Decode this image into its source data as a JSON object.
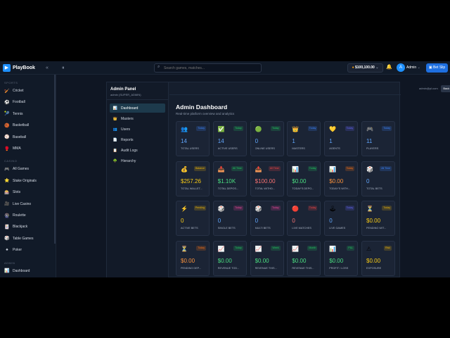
{
  "app": {
    "name": "PlayBook",
    "collapse_icon": "«",
    "menu_icon": "⏸"
  },
  "header": {
    "search_placeholder": "Search games, matches...",
    "balance": "$100,100.00",
    "user": "Admin",
    "avatar_letter": "A",
    "bet_slip": "Bet Slip"
  },
  "sidebar": {
    "sections": [
      {
        "title": "SPORTS",
        "items": [
          {
            "label": "Cricket",
            "icon": "🏏"
          },
          {
            "label": "Football",
            "icon": "⚽"
          },
          {
            "label": "Tennis",
            "icon": "🎾"
          },
          {
            "label": "Basketball",
            "icon": "🏀"
          },
          {
            "label": "Baseball",
            "icon": "⚾"
          },
          {
            "label": "MMA",
            "icon": "🥊"
          }
        ]
      },
      {
        "title": "CASINO",
        "items": [
          {
            "label": "All Games",
            "icon": "🎮"
          },
          {
            "label": "Stake Originals",
            "icon": "⭐"
          },
          {
            "label": "Slots",
            "icon": "🎰"
          },
          {
            "label": "Live Casino",
            "icon": "🎥"
          },
          {
            "label": "Roulette",
            "icon": "🎡"
          },
          {
            "label": "Blackjack",
            "icon": "🃏"
          },
          {
            "label": "Table Games",
            "icon": "🎲"
          },
          {
            "label": "Poker",
            "icon": "♠"
          }
        ]
      },
      {
        "title": "ADMIN",
        "items": [
          {
            "label": "Dashboard",
            "icon": "📊"
          }
        ]
      }
    ]
  },
  "admin_panel": {
    "title": "Admin Panel",
    "subtitle": "admin (SUPER_ADMIN)",
    "email": "admin@pl.com",
    "back_label": "Back to Site",
    "nav": [
      {
        "label": "Dashboard",
        "icon": "📊",
        "active": true
      },
      {
        "label": "Masters",
        "icon": "👑",
        "active": false
      },
      {
        "label": "Users",
        "icon": "👥",
        "active": false
      },
      {
        "label": "Reports",
        "icon": "📄",
        "active": false
      },
      {
        "label": "Audit Logs",
        "icon": "📋",
        "active": false
      },
      {
        "label": "Hierarchy",
        "icon": "🌳",
        "active": false
      }
    ]
  },
  "dashboard": {
    "title": "Admin Dashboard",
    "subtitle": "Real-time platform overview and analytics",
    "cards": [
      {
        "icon": "👥",
        "badge": "Today",
        "badge_color": "#3b82f6",
        "value": "14",
        "value_color": "#60a5fa",
        "label": "TOTAL USERS"
      },
      {
        "icon": "✅",
        "badge": "Today",
        "badge_color": "#22c55e",
        "value": "14",
        "value_color": "#60a5fa",
        "label": "ACTIVE USERS"
      },
      {
        "icon": "🟢",
        "badge": "Today",
        "badge_color": "#22c55e",
        "value": "0",
        "value_color": "#60a5fa",
        "label": "ONLINE USERS"
      },
      {
        "icon": "👑",
        "badge": "Today",
        "badge_color": "#3b82f6",
        "value": "1",
        "value_color": "#60a5fa",
        "label": "MASTERS"
      },
      {
        "icon": "💛",
        "badge": "Today",
        "badge_color": "#6366f1",
        "value": "1",
        "value_color": "#60a5fa",
        "label": "AGENTS"
      },
      {
        "icon": "🎮",
        "badge": "Today",
        "badge_color": "#3b82f6",
        "value": "11",
        "value_color": "#60a5fa",
        "label": "PLAYERS"
      },
      {
        "icon": "💰",
        "badge": "Balance",
        "badge_color": "#eab308",
        "value": "$257.26",
        "value_color": "#facc15",
        "label": "TOTAL WALLET..."
      },
      {
        "icon": "📥",
        "badge": "All Time",
        "badge_color": "#22c55e",
        "value": "$1.10K",
        "value_color": "#4ade80",
        "label": "TOTAL DEPOS..."
      },
      {
        "icon": "📤",
        "badge": "All Time",
        "badge_color": "#ef4444",
        "value": "$100.00",
        "value_color": "#f87171",
        "label": "TOTAL WITHD..."
      },
      {
        "icon": "📊",
        "badge": "Today",
        "badge_color": "#22c55e",
        "value": "$0.00",
        "value_color": "#4ade80",
        "label": "TODAY'S DEPO..."
      },
      {
        "icon": "📊",
        "badge": "Today",
        "badge_color": "#f97316",
        "value": "$0.00",
        "value_color": "#fb923c",
        "label": "TODAY'S WITH..."
      },
      {
        "icon": "🎲",
        "badge": "All Time",
        "badge_color": "#3b82f6",
        "value": "0",
        "value_color": "#60a5fa",
        "label": "TOTAL BETS"
      },
      {
        "icon": "⚡",
        "badge": "Pending",
        "badge_color": "#eab308",
        "value": "0",
        "value_color": "#facc15",
        "label": "ACTIVE BETS"
      },
      {
        "icon": "🎲",
        "badge": "Today",
        "badge_color": "#ec4899",
        "value": "0",
        "value_color": "#60a5fa",
        "label": "SINGLE BETS"
      },
      {
        "icon": "🎲",
        "badge": "Today",
        "badge_color": "#ec4899",
        "value": "0",
        "value_color": "#60a5fa",
        "label": "MULTI BETS"
      },
      {
        "icon": "🔴",
        "badge": "Today",
        "badge_color": "#ef4444",
        "value": "0",
        "value_color": "#f87171",
        "label": "LIVE MATCHES"
      },
      {
        "icon": "🕹",
        "badge": "Today",
        "badge_color": "#6366f1",
        "value": "0",
        "value_color": "#60a5fa",
        "label": "LIVE GAMES"
      },
      {
        "icon": "⏳",
        "badge": "Today",
        "badge_color": "#eab308",
        "value": "$0.00",
        "value_color": "#facc15",
        "label": "PENDING WIT..."
      },
      {
        "icon": "⏳",
        "badge": "Today",
        "badge_color": "#f97316",
        "value": "$0.00",
        "value_color": "#fb923c",
        "label": "PENDING DEP..."
      },
      {
        "icon": "📈",
        "badge": "Today",
        "badge_color": "#22c55e",
        "value": "$0.00",
        "value_color": "#4ade80",
        "label": "REVENUE TOD..."
      },
      {
        "icon": "📈",
        "badge": "Week",
        "badge_color": "#22c55e",
        "value": "$0.00",
        "value_color": "#4ade80",
        "label": "REVENUE THIS..."
      },
      {
        "icon": "📈",
        "badge": "Month",
        "badge_color": "#22c55e",
        "value": "$0.00",
        "value_color": "#4ade80",
        "label": "REVENUE THIS..."
      },
      {
        "icon": "📊",
        "badge": "P&L",
        "badge_color": "#22c55e",
        "value": "$0.00",
        "value_color": "#4ade80",
        "label": "PROFIT / LOSS"
      },
      {
        "icon": "⚠",
        "badge": "Risk",
        "badge_color": "#eab308",
        "value": "$0.00",
        "value_color": "#facc15",
        "label": "EXPOSURE"
      }
    ]
  }
}
